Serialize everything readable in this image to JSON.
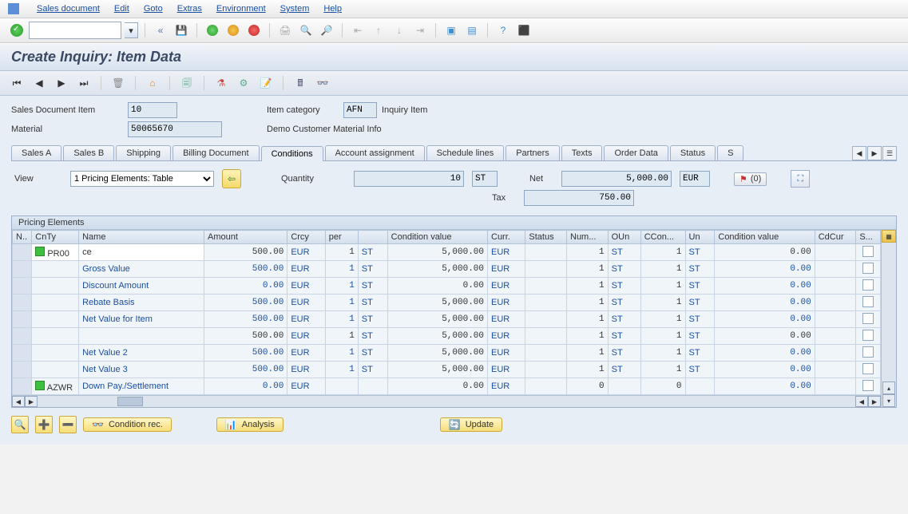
{
  "menu": {
    "items": [
      "Sales document",
      "Edit",
      "Goto",
      "Extras",
      "Environment",
      "System",
      "Help"
    ]
  },
  "title": "Create Inquiry: Item Data",
  "header": {
    "sdi_label": "Sales Document Item",
    "sdi_value": "10",
    "itemcat_label": "Item category",
    "itemcat_value": "AFN",
    "itemcat_text": "Inquiry Item",
    "material_label": "Material",
    "material_value": "50065670",
    "material_text": "Demo Customer Material Info"
  },
  "tabs": [
    "Sales A",
    "Sales B",
    "Shipping",
    "Billing Document",
    "Conditions",
    "Account assignment",
    "Schedule lines",
    "Partners",
    "Texts",
    "Order Data",
    "Status",
    "S"
  ],
  "active_tab": 4,
  "cond": {
    "view_label": "View",
    "view_select": "1 Pricing Elements: Table",
    "qty_label": "Quantity",
    "qty_value": "10",
    "qty_unit": "ST",
    "net_label": "Net",
    "net_value": "5,000.00",
    "net_curr": "EUR",
    "tax_label": "Tax",
    "tax_value": "750.00",
    "badge": "(0)"
  },
  "grid": {
    "title": "Pricing Elements",
    "cols": [
      "N..",
      "CnTy",
      "Name",
      "Amount",
      "Crcy",
      "per",
      "",
      "Condition value",
      "Curr.",
      "Status",
      "Num...",
      "OUn",
      "CCon...",
      "Un",
      "Condition value",
      "CdCur",
      "S..."
    ],
    "rows": [
      {
        "status": "g",
        "cnty": "PR00",
        "cnty_edit": true,
        "name": "ce",
        "name_edit": true,
        "amount": "500.00",
        "crcy": "EUR",
        "per": "1",
        "puom": "ST",
        "condval": "5,000.00",
        "curr": "EUR",
        "num": "1",
        "oun": "ST",
        "ccon": "1",
        "un": "ST",
        "cv2": "0.00"
      },
      {
        "name": "Gross Value",
        "link": true,
        "amount": "500.00",
        "crcy": "EUR",
        "per": "1",
        "puom": "ST",
        "condval": "5,000.00",
        "curr": "EUR",
        "num": "1",
        "oun": "ST",
        "ccon": "1",
        "un": "ST",
        "cv2": "0.00"
      },
      {
        "name": "Discount Amount",
        "link": true,
        "amount": "0.00",
        "crcy": "EUR",
        "per": "1",
        "puom": "ST",
        "condval": "0.00",
        "curr": "EUR",
        "num": "1",
        "oun": "ST",
        "ccon": "1",
        "un": "ST",
        "cv2": "0.00"
      },
      {
        "name": "Rebate Basis",
        "link": true,
        "amount": "500.00",
        "crcy": "EUR",
        "per": "1",
        "puom": "ST",
        "condval": "5,000.00",
        "curr": "EUR",
        "num": "1",
        "oun": "ST",
        "ccon": "1",
        "un": "ST",
        "cv2": "0.00"
      },
      {
        "name": "Net Value for Item",
        "link": true,
        "amount": "500.00",
        "crcy": "EUR",
        "per": "1",
        "puom": "ST",
        "condval": "5,000.00",
        "curr": "EUR",
        "num": "1",
        "oun": "ST",
        "ccon": "1",
        "un": "ST",
        "cv2": "0.00"
      },
      {
        "name": "",
        "amount": "500.00",
        "crcy": "EUR",
        "per": "1",
        "puom": "ST",
        "condval": "5,000.00",
        "curr": "EUR",
        "num": "1",
        "oun": "ST",
        "ccon": "1",
        "un": "ST",
        "cv2": "0.00"
      },
      {
        "name": "Net Value 2",
        "link": true,
        "amount": "500.00",
        "crcy": "EUR",
        "per": "1",
        "puom": "ST",
        "condval": "5,000.00",
        "curr": "EUR",
        "num": "1",
        "oun": "ST",
        "ccon": "1",
        "un": "ST",
        "cv2": "0.00"
      },
      {
        "name": "Net Value 3",
        "link": true,
        "amount": "500.00",
        "crcy": "EUR",
        "per": "1",
        "puom": "ST",
        "condval": "5,000.00",
        "curr": "EUR",
        "num": "1",
        "oun": "ST",
        "ccon": "1",
        "un": "ST",
        "cv2": "0.00"
      },
      {
        "status": "g",
        "cnty": "AZWR",
        "name": "Down Pay./Settlement",
        "link": true,
        "amount": "0.00",
        "crcy": "EUR",
        "per": "",
        "puom": "",
        "condval": "0.00",
        "curr": "EUR",
        "num": "0",
        "oun": "",
        "ccon": "0",
        "un": "",
        "cv2": "0.00"
      }
    ]
  },
  "buttons": {
    "cond_rec": "Condition rec.",
    "analysis": "Analysis",
    "update": "Update"
  }
}
